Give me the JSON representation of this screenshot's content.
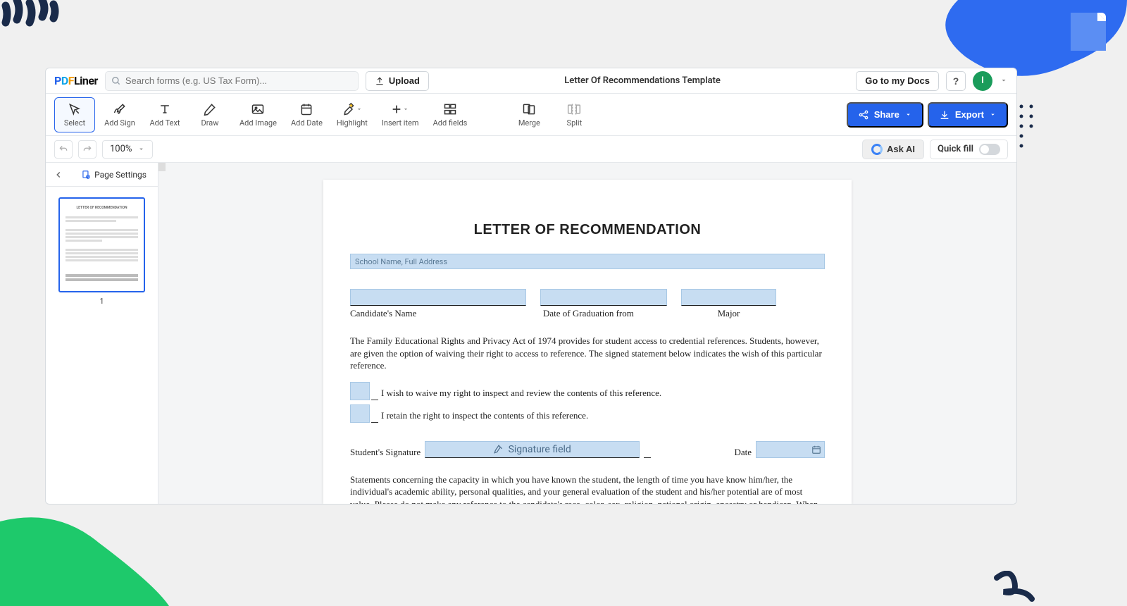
{
  "brand": {
    "name": "PDFLiner"
  },
  "search": {
    "placeholder": "Search forms (e.g. US Tax Form)..."
  },
  "header": {
    "upload": "Upload",
    "doc_title": "Letter Of Recommendations Template",
    "go_docs": "Go to my Docs",
    "help": "?",
    "avatar_initial": "I"
  },
  "tools": {
    "select": "Select",
    "sign": "Add Sign",
    "text": "Add Text",
    "draw": "Draw",
    "image": "Add Image",
    "date": "Add Date",
    "highlight": "Highlight",
    "insert": "Insert item",
    "fields": "Add fields",
    "merge": "Merge",
    "split": "Split",
    "share": "Share",
    "export": "Export"
  },
  "subbar": {
    "zoom": "100%",
    "askai": "Ask AI",
    "quickfill": "Quick fill"
  },
  "sidebar": {
    "page_settings": "Page Settings",
    "page_num": "1"
  },
  "doc": {
    "title": "LETTER OF RECOMMENDATION",
    "school_placeholder": "School Name, Full Address",
    "labels": {
      "candidate": "Candidate's Name",
      "grad": "Date of Graduation from",
      "major": "Major",
      "signature": "Student's Signature",
      "date": "Date",
      "sig_field": "Signature field"
    },
    "para1": "The Family Educational Rights and Privacy Act of 1974 provides for student access to credential references. Students, however, are given the option of waiving their right to access to reference.  The signed statement below indicates the wish of this particular reference.",
    "waive": "I wish to waive my right to inspect and review the contents of this reference.",
    "retain": "I retain the right to inspect the contents of this reference.",
    "para2": "Statements concerning the capacity in which you have known the student, the length of time you have know him/her, the individual's academic ability, personal qualities, and your general evaluation of the student and his/her potential are of most value.  Please do not make any reference to the candidate's race, color, sex, religion, national origin, ancestry or handicap.  When typed, please return to the above address."
  }
}
